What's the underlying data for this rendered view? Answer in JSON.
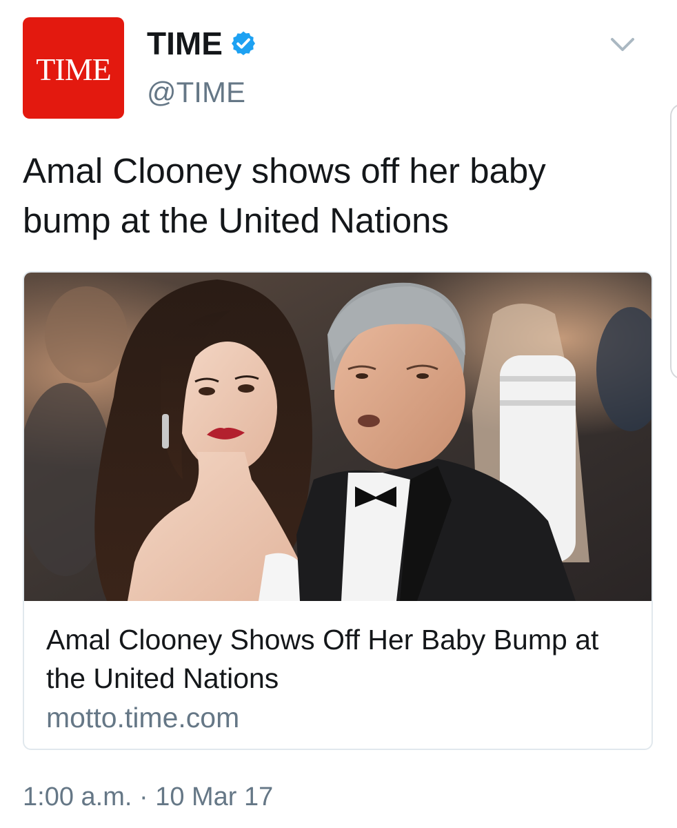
{
  "tweet": {
    "avatar_text": "TIME",
    "display_name": "TIME",
    "verified": true,
    "handle": "@TIME",
    "text": "Amal Clooney shows off her baby bump at the United Nations",
    "timestamp": "1:00 a.m. · 10 Mar 17"
  },
  "card": {
    "image_icon": "photo-couple-red-carpet",
    "title": "Amal Clooney Shows Off Her Baby Bump at the United Nations",
    "domain": "motto.time.com"
  },
  "colors": {
    "brand_red": "#e3190f",
    "verified_blue": "#1da1f2",
    "muted_text": "#657786",
    "text": "#14171a",
    "card_border": "#e1e8ed"
  }
}
